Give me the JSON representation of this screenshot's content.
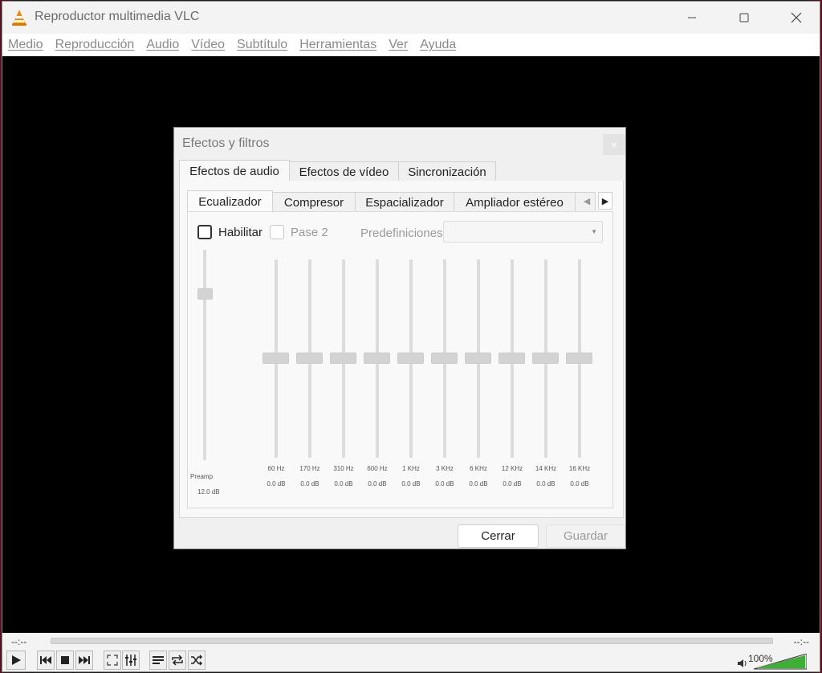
{
  "window": {
    "title": "Reproductor multimedia VLC",
    "minimize_icon": "minimize-icon",
    "maximize_icon": "maximize-icon",
    "close_icon": "close-icon"
  },
  "menubar": {
    "items": [
      "Medio",
      "Reproducción",
      "Audio",
      "Vídeo",
      "Subtítulo",
      "Herramientas",
      "Ver",
      "Ayuda"
    ]
  },
  "controls": {
    "time_elapsed": "--:--",
    "time_total": "--:--",
    "volume_percent": "100%",
    "volume_level": 1.0,
    "buttons": [
      "play-icon",
      "previous-icon",
      "stop-icon",
      "next-icon",
      "fullscreen-icon",
      "extended-settings-icon",
      "playlist-icon",
      "loop-icon",
      "shuffle-icon"
    ]
  },
  "dialog": {
    "title": "Efectos y filtros",
    "close_symbol": "×",
    "tabs": [
      "Efectos de audio",
      "Efectos de vídeo",
      "Sincronización"
    ],
    "active_tab": "Efectos de audio",
    "inner_tabs": [
      "Ecualizador",
      "Compresor",
      "Espacializador",
      "Ampliador estéreo"
    ],
    "active_inner_tab": "Ecualizador",
    "enable_label": "Habilitar",
    "pass2_label": "Pase 2",
    "presets_label": "Predefiniciones",
    "preset_value": "",
    "preamp": {
      "label": "Preamp",
      "value": "12.0 dB"
    },
    "bands": [
      {
        "freq": "60 Hz",
        "value": "0.0 dB"
      },
      {
        "freq": "170 Hz",
        "value": "0.0 dB"
      },
      {
        "freq": "310 Hz",
        "value": "0.0 dB"
      },
      {
        "freq": "600 Hz",
        "value": "0.0 dB"
      },
      {
        "freq": "1 KHz",
        "value": "0.0 dB"
      },
      {
        "freq": "3 KHz",
        "value": "0.0 dB"
      },
      {
        "freq": "6 KHz",
        "value": "0.0 dB"
      },
      {
        "freq": "12 KHz",
        "value": "0.0 dB"
      },
      {
        "freq": "14 KHz",
        "value": "0.0 dB"
      },
      {
        "freq": "16 KHz",
        "value": "0.0 dB"
      }
    ],
    "close_button": "Cerrar",
    "save_button": "Guardar"
  }
}
